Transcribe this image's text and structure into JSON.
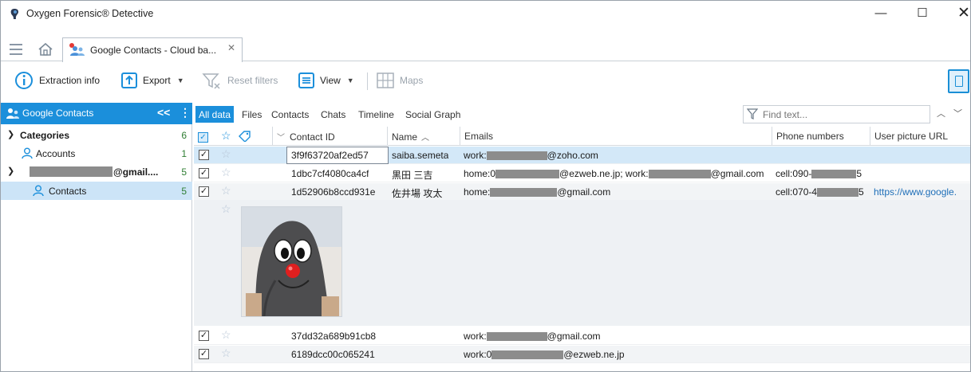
{
  "window": {
    "title": "Oxygen Forensic® Detective",
    "minimize": "—",
    "maximize": "☐",
    "close": "✕"
  },
  "doc_tab": {
    "label": "Google Contacts - Cloud ba...",
    "close": "✕"
  },
  "toolbar": {
    "extraction_info": "Extraction info",
    "export": "Export",
    "reset_filters": "Reset filters",
    "view": "View",
    "maps": "Maps"
  },
  "left_panel": {
    "header": "Google Contacts",
    "collapse": "<<",
    "more": "⋮",
    "tree": {
      "categories": {
        "label": "Categories",
        "count": "6"
      },
      "accounts": {
        "label": "Accounts",
        "count": "1"
      },
      "gmail": {
        "label": "@gmail....",
        "count": "5"
      },
      "contacts": {
        "label": "Contacts",
        "count": "5"
      }
    }
  },
  "view_tabs": [
    "All data",
    "Files",
    "Contacts",
    "Chats",
    "Timeline",
    "Social Graph"
  ],
  "search": {
    "placeholder": "Find text..."
  },
  "grid": {
    "columns": {
      "contact_id": "Contact ID",
      "name": "Name",
      "emails": "Emails",
      "phone": "Phone numbers",
      "picture": "User picture URL"
    },
    "rows": [
      {
        "contact_id": "3f9f63720af2ed57",
        "name": "saiba.semeta",
        "email_prefix": "work:",
        "email_suffix": "@zoho.com",
        "phone_prefix": "",
        "phone_suffix": "",
        "picture": ""
      },
      {
        "contact_id": "1dbc7cf4080ca4cf",
        "name": "黒田 三吉",
        "email_prefix": "home:0",
        "email_suffix": "@ezweb.ne.jp; work:",
        "email_suffix2": "@gmail.com",
        "phone_prefix": "cell:090-",
        "phone_suffix": "5",
        "picture": ""
      },
      {
        "contact_id": "1d52906b8ccd931e",
        "name": "佐井場 攻太",
        "email_prefix": "home:",
        "email_suffix": "@gmail.com",
        "phone_prefix": "cell:070-4",
        "phone_suffix": "5",
        "picture": "https://www.google."
      },
      {
        "contact_id": "37dd32a689b91cb8",
        "name": "",
        "email_prefix": "work:",
        "email_suffix": "@gmail.com",
        "phone_prefix": "",
        "phone_suffix": "",
        "picture": ""
      },
      {
        "contact_id": "6189dcc00c065241",
        "name": "",
        "email_prefix": "work:0",
        "email_suffix": "@ezweb.ne.jp",
        "phone_prefix": "",
        "phone_suffix": "",
        "picture": ""
      }
    ]
  },
  "colors": {
    "accent": "#1b8fdb",
    "selected_row": "#d3e8f8",
    "count_green": "#2e7d32",
    "link": "#1f6fb8"
  },
  "icons": [
    "app-logo-icon",
    "hamburger-icon",
    "home-icon",
    "contacts-icon",
    "extraction-info-icon",
    "export-icon",
    "reset-filters-icon",
    "view-icon",
    "maps-icon",
    "filter-icon",
    "star-icon",
    "tag-icon",
    "checkbox-icon"
  ]
}
